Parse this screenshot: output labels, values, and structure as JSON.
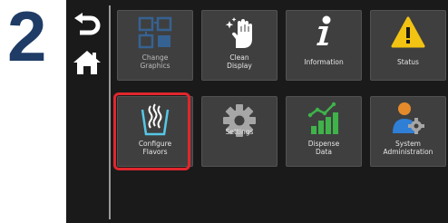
{
  "step": {
    "number": "2"
  },
  "nav": {
    "back_icon": "return-arrow-icon",
    "home_icon": "home-icon"
  },
  "tiles": [
    {
      "id": "change-graphics",
      "label": "Change\nGraphics",
      "icon": "change-graphics-icon",
      "state": "disabled"
    },
    {
      "id": "clean-display",
      "label": "Clean\nDisplay",
      "icon": "hand-sparkle-icon",
      "state": "enabled"
    },
    {
      "id": "information",
      "label": "Information",
      "icon": "info-icon",
      "state": "enabled"
    },
    {
      "id": "status",
      "label": "Status",
      "icon": "warning-icon",
      "state": "enabled"
    },
    {
      "id": "configure-flavors",
      "label": "Configure\nFlavors",
      "icon": "flavor-cup-icon",
      "state": "highlighted"
    },
    {
      "id": "settings",
      "label": "Settings",
      "icon": "gear-icon",
      "state": "enabled"
    },
    {
      "id": "dispense-data",
      "label": "Dispense\nData",
      "icon": "bar-chart-icon",
      "state": "enabled"
    },
    {
      "id": "system-administration",
      "label": "System\nAdministration",
      "icon": "admin-user-gear-icon",
      "state": "enabled"
    }
  ],
  "colors": {
    "step_number": "#1f3c66",
    "screen_bg": "#1a1a1a",
    "tile_bg": "#3f3f3f",
    "highlight": "#e0262d",
    "accent_blue": "#2f7fd6",
    "accent_cyan": "#56c7e6",
    "accent_green": "#3fb24a",
    "accent_yellow": "#f2c312",
    "accent_orange": "#e58a2b"
  }
}
